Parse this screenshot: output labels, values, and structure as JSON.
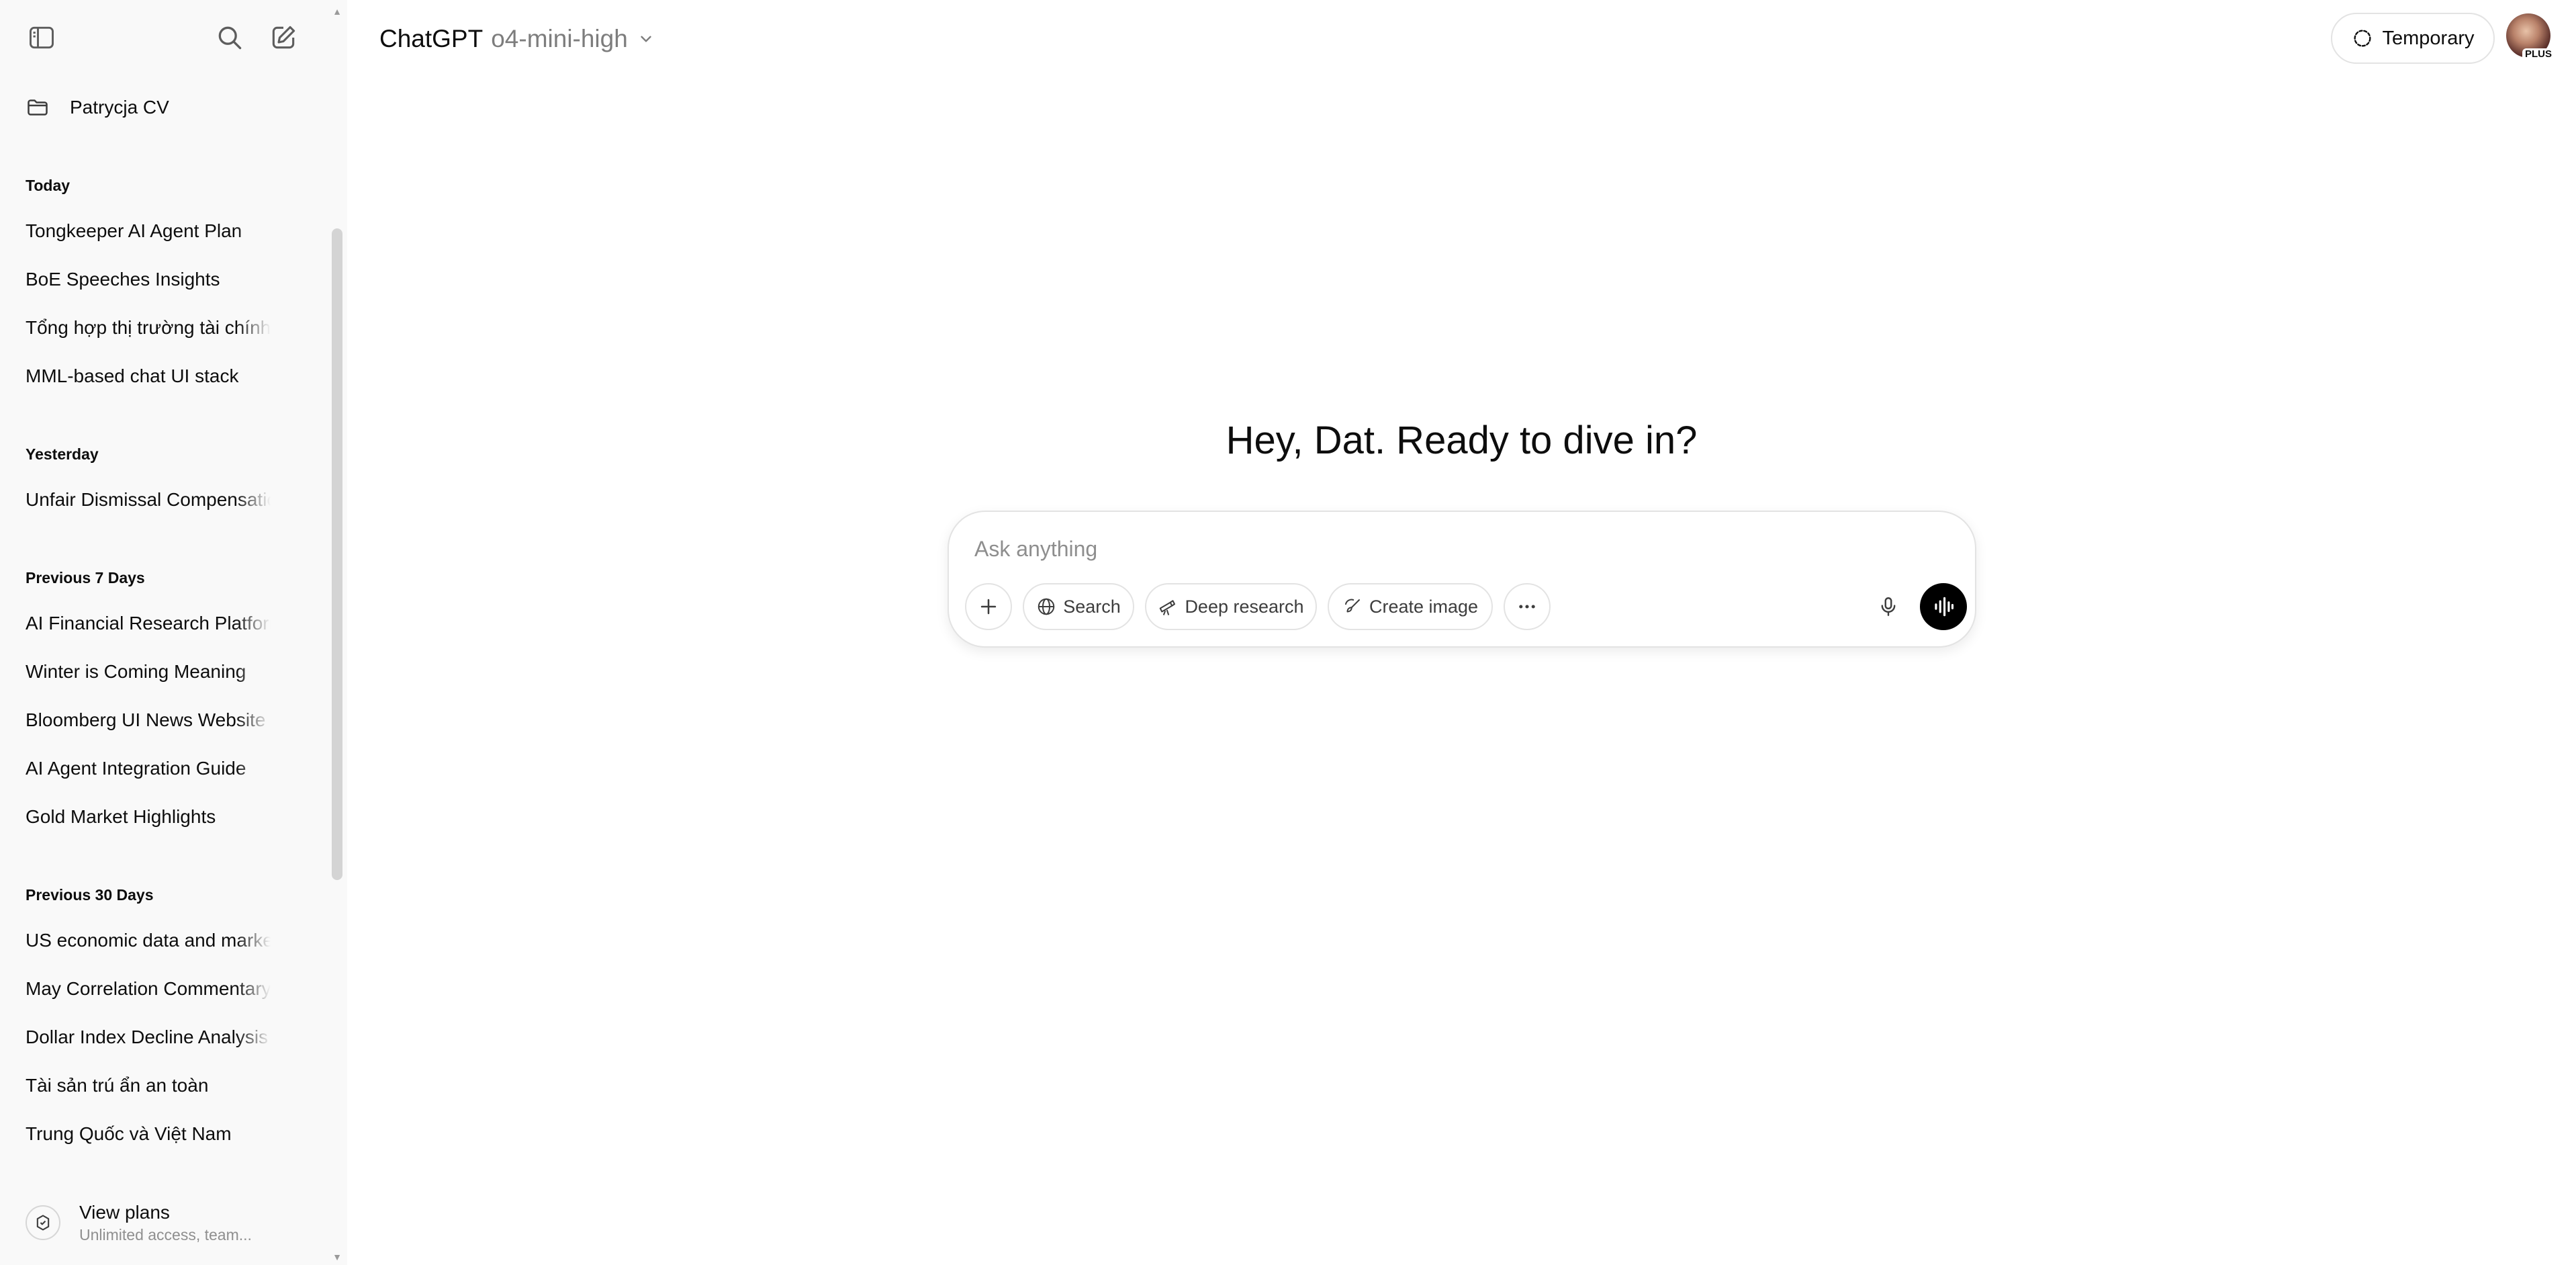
{
  "sidebar": {
    "project": "Patrycja CV",
    "sections": [
      {
        "label": "Today",
        "items": [
          "Tongkeeper AI Agent Plan",
          "BoE Speeches Insights",
          "Tổng hợp thị trường tài chính",
          "MML-based chat UI stack"
        ]
      },
      {
        "label": "Yesterday",
        "items": [
          "Unfair Dismissal Compensation"
        ]
      },
      {
        "label": "Previous 7 Days",
        "items": [
          "AI Financial Research Platform",
          "Winter is Coming Meaning",
          "Bloomberg UI News Website",
          "AI Agent Integration Guide",
          "Gold Market Highlights"
        ]
      },
      {
        "label": "Previous 30 Days",
        "items": [
          "US economic data and market",
          "May Correlation Commentary",
          "Dollar Index Decline Analysis",
          "Tài sản trú ẩn an toàn",
          "Trung Quốc và Việt Nam"
        ]
      }
    ],
    "view_plans": {
      "title": "View plans",
      "subtitle": "Unlimited access, team..."
    }
  },
  "header": {
    "brand": "ChatGPT",
    "model": "o4-mini-high",
    "temporary_label": "Temporary",
    "avatar_badge": "PLUS"
  },
  "main": {
    "greeting": "Hey, Dat. Ready to dive in?",
    "composer": {
      "placeholder": "Ask anything",
      "search_label": "Search",
      "deep_research_label": "Deep research",
      "create_image_label": "Create image"
    }
  },
  "icons": [
    "sidebar-toggle-icon",
    "search-icon",
    "new-chat-icon",
    "folder-icon",
    "chevron-down-icon",
    "temporary-chat-icon",
    "plus-icon",
    "globe-icon",
    "telescope-icon",
    "paintbrush-icon",
    "more-icon",
    "microphone-icon",
    "voice-mode-icon",
    "plans-icon"
  ]
}
